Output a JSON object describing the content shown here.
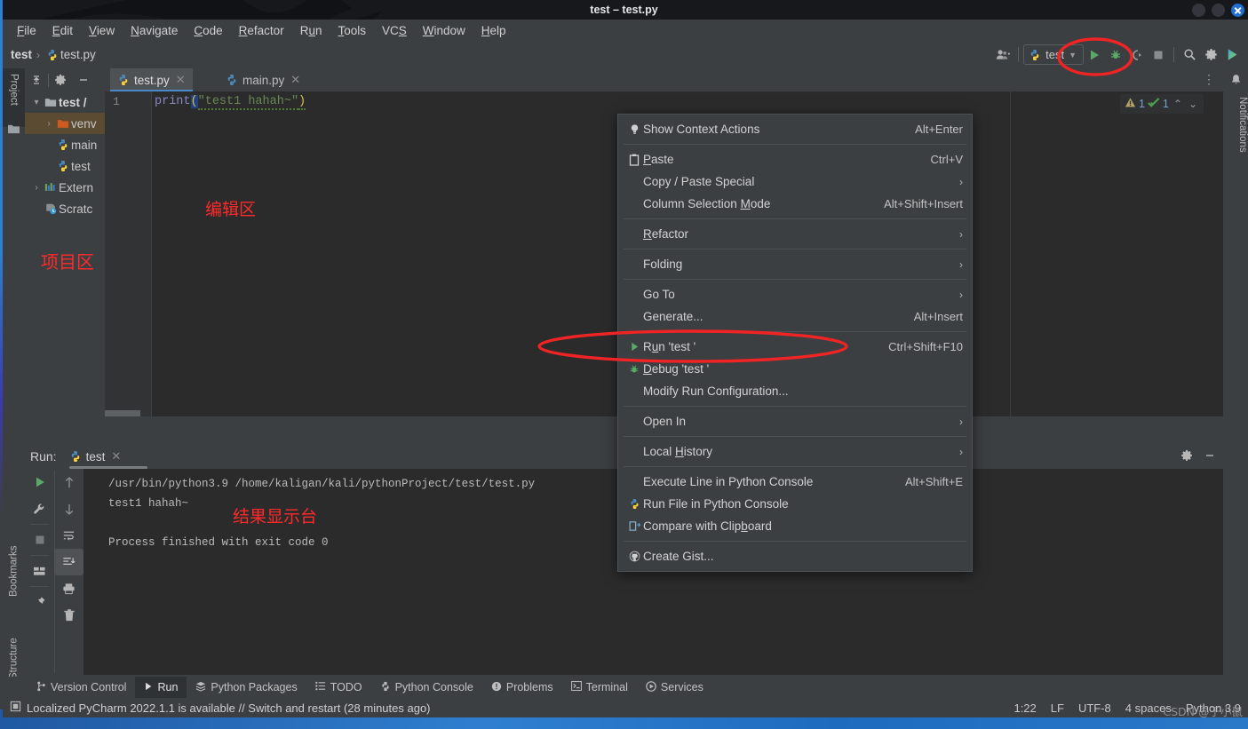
{
  "window": {
    "title": "test – test.py",
    "buttons": [
      "minimize",
      "maximize",
      "close"
    ]
  },
  "menubar": {
    "items": [
      {
        "label": "File",
        "mnemonic": "F"
      },
      {
        "label": "Edit",
        "mnemonic": "E"
      },
      {
        "label": "View",
        "mnemonic": "V"
      },
      {
        "label": "Navigate",
        "mnemonic": "N"
      },
      {
        "label": "Code",
        "mnemonic": "C"
      },
      {
        "label": "Refactor",
        "mnemonic": "R"
      },
      {
        "label": "Run",
        "mnemonic": "u"
      },
      {
        "label": "Tools",
        "mnemonic": "T"
      },
      {
        "label": "VCS",
        "mnemonic": "S"
      },
      {
        "label": "Window",
        "mnemonic": "W"
      },
      {
        "label": "Help",
        "mnemonic": "H"
      }
    ]
  },
  "breadcrumb": {
    "project": "test",
    "separator": "›",
    "file": "test.py"
  },
  "toolbar": {
    "run_config_name": "test",
    "icons": [
      "user-avatar-icon",
      "python-icon",
      "chevron-down-icon",
      "run-icon",
      "debug-icon",
      "coverage-icon",
      "stop-icon",
      "search-icon",
      "gear-icon",
      "updates-icon"
    ]
  },
  "editor_tabs": {
    "tools": [
      "collapse-icon",
      "gear-icon",
      "minimize-icon"
    ],
    "tabs": [
      {
        "label": "test.py",
        "active": true
      },
      {
        "label": "main.py",
        "active": false
      }
    ],
    "more": "⋮"
  },
  "left_strip": {
    "top": [
      {
        "label": "Project",
        "selected": true
      }
    ],
    "bottom": [
      {
        "label": "Bookmarks"
      },
      {
        "label": "Structure"
      }
    ]
  },
  "right_strip": {
    "notifications_label": "Notifications"
  },
  "project_tree": {
    "items": [
      {
        "label": "test /",
        "icon": "folder-icon",
        "expanded": true,
        "bold": true,
        "indent": 0,
        "selected": false
      },
      {
        "label": "venv",
        "icon": "folder-orange-icon",
        "expanded": false,
        "bold": false,
        "indent": 1,
        "selected": true
      },
      {
        "label": "main",
        "icon": "python-file-icon",
        "expanded": null,
        "bold": false,
        "indent": 2,
        "selected": false
      },
      {
        "label": "test",
        "icon": "python-file-icon",
        "expanded": null,
        "bold": false,
        "indent": 2,
        "selected": false
      },
      {
        "label": "Extern",
        "icon": "libraries-icon",
        "expanded": false,
        "bold": false,
        "indent": 0,
        "selected": false
      },
      {
        "label": "Scratc",
        "icon": "scratches-icon",
        "expanded": null,
        "bold": false,
        "indent": 1,
        "selected": false
      }
    ]
  },
  "editor": {
    "line_number": "1",
    "code": {
      "fn": "print",
      "open_paren": "(",
      "string": "\"test1 hahah~\"",
      "close_paren": ")"
    },
    "inspections": {
      "warning_count": "1",
      "ok_count": "1",
      "up": "⌃",
      "down": "⌄"
    }
  },
  "annotations": [
    {
      "text": "项目区",
      "meaning": "project-area"
    },
    {
      "text": "编辑区",
      "meaning": "editor-area"
    },
    {
      "text": "结果显示台",
      "meaning": "result-console-area"
    }
  ],
  "context_menu": {
    "items": [
      {
        "label": "Show Context Actions",
        "shortcut": "Alt+Enter",
        "icon": "lightbulb-icon",
        "submenu": false,
        "mnemonic": ""
      },
      {
        "separator": true
      },
      {
        "label": "Paste",
        "shortcut": "Ctrl+V",
        "icon": "clipboard-icon",
        "submenu": false,
        "mnemonic": "P"
      },
      {
        "label": "Copy / Paste Special",
        "shortcut": "",
        "icon": "",
        "submenu": true,
        "mnemonic": ""
      },
      {
        "label": "Column Selection Mode",
        "shortcut": "Alt+Shift+Insert",
        "icon": "",
        "submenu": false,
        "mnemonic": "M"
      },
      {
        "separator": true
      },
      {
        "label": "Refactor",
        "shortcut": "",
        "icon": "",
        "submenu": true,
        "mnemonic": "R"
      },
      {
        "separator": true
      },
      {
        "label": "Folding",
        "shortcut": "",
        "icon": "",
        "submenu": true,
        "mnemonic": ""
      },
      {
        "separator": true
      },
      {
        "label": "Go To",
        "shortcut": "",
        "icon": "",
        "submenu": true,
        "mnemonic": ""
      },
      {
        "label": "Generate...",
        "shortcut": "Alt+Insert",
        "icon": "",
        "submenu": false,
        "mnemonic": ""
      },
      {
        "separator": true
      },
      {
        "label": "Run 'test '",
        "shortcut": "Ctrl+Shift+F10",
        "icon": "run-icon",
        "submenu": false,
        "mnemonic": "u",
        "highlighted": true
      },
      {
        "label": "Debug 'test '",
        "shortcut": "",
        "icon": "debug-icon",
        "submenu": false,
        "mnemonic": "D"
      },
      {
        "label": "Modify Run Configuration...",
        "shortcut": "",
        "icon": "",
        "submenu": false,
        "mnemonic": ""
      },
      {
        "separator": true
      },
      {
        "label": "Open In",
        "shortcut": "",
        "icon": "",
        "submenu": true,
        "mnemonic": ""
      },
      {
        "separator": true
      },
      {
        "label": "Local History",
        "shortcut": "",
        "icon": "",
        "submenu": true,
        "mnemonic": "H"
      },
      {
        "separator": true
      },
      {
        "label": "Execute Line in Python Console",
        "shortcut": "Alt+Shift+E",
        "icon": "",
        "submenu": false,
        "mnemonic": ""
      },
      {
        "label": "Run File in Python Console",
        "shortcut": "",
        "icon": "python-icon",
        "submenu": false,
        "mnemonic": ""
      },
      {
        "label": "Compare with Clipboard",
        "shortcut": "",
        "icon": "compare-icon",
        "submenu": false,
        "mnemonic": "b"
      },
      {
        "separator": true
      },
      {
        "label": "Create Gist...",
        "shortcut": "",
        "icon": "github-icon",
        "submenu": false,
        "mnemonic": ""
      }
    ]
  },
  "run_window": {
    "title": "Run:",
    "tab_label": "test",
    "left_icons": [
      "run-icon",
      "wrench-icon",
      "stop-icon",
      "layout-icon",
      "pin-icon"
    ],
    "right_icons": [
      "arrow-up-icon",
      "arrow-down-icon",
      "soft-wrap-icon",
      "scroll-to-end-icon",
      "print-icon",
      "trash-icon"
    ],
    "header_icons": [
      "gear-icon",
      "minimize-icon"
    ],
    "console_lines": [
      "/usr/bin/python3.9 /home/kaligan/kali/pythonProject/test/test.py",
      "test1 hahah~",
      "",
      "Process finished with exit code 0"
    ]
  },
  "bottom_tabs": [
    {
      "label": "Version Control",
      "icon": "branch-icon",
      "selected": false
    },
    {
      "label": "Run",
      "icon": "run-icon",
      "selected": true
    },
    {
      "label": "Python Packages",
      "icon": "packages-icon",
      "selected": false
    },
    {
      "label": "TODO",
      "icon": "todo-icon",
      "selected": false
    },
    {
      "label": "Python Console",
      "icon": "python-icon",
      "selected": false
    },
    {
      "label": "Problems",
      "icon": "problems-icon",
      "selected": false
    },
    {
      "label": "Terminal",
      "icon": "terminal-icon",
      "selected": false
    },
    {
      "label": "Services",
      "icon": "services-icon",
      "selected": false
    }
  ],
  "status_bar": {
    "message": "Localized PyCharm 2022.1.1 is available // Switch and restart (28 minutes ago)",
    "message_icon": "notification-icon",
    "caret": "1:22",
    "line_separator": "LF",
    "encoding": "UTF-8",
    "indent": "4 spaces",
    "interpreter": "Python 3.9"
  },
  "watermark": "CSDN @于小鼠",
  "colors": {
    "accent": "#4a88c7",
    "ink_red": "#ff2a2a",
    "panel_bg": "#3c3f41",
    "editor_bg": "#2b2b2b",
    "selection": "#5b4b33"
  }
}
